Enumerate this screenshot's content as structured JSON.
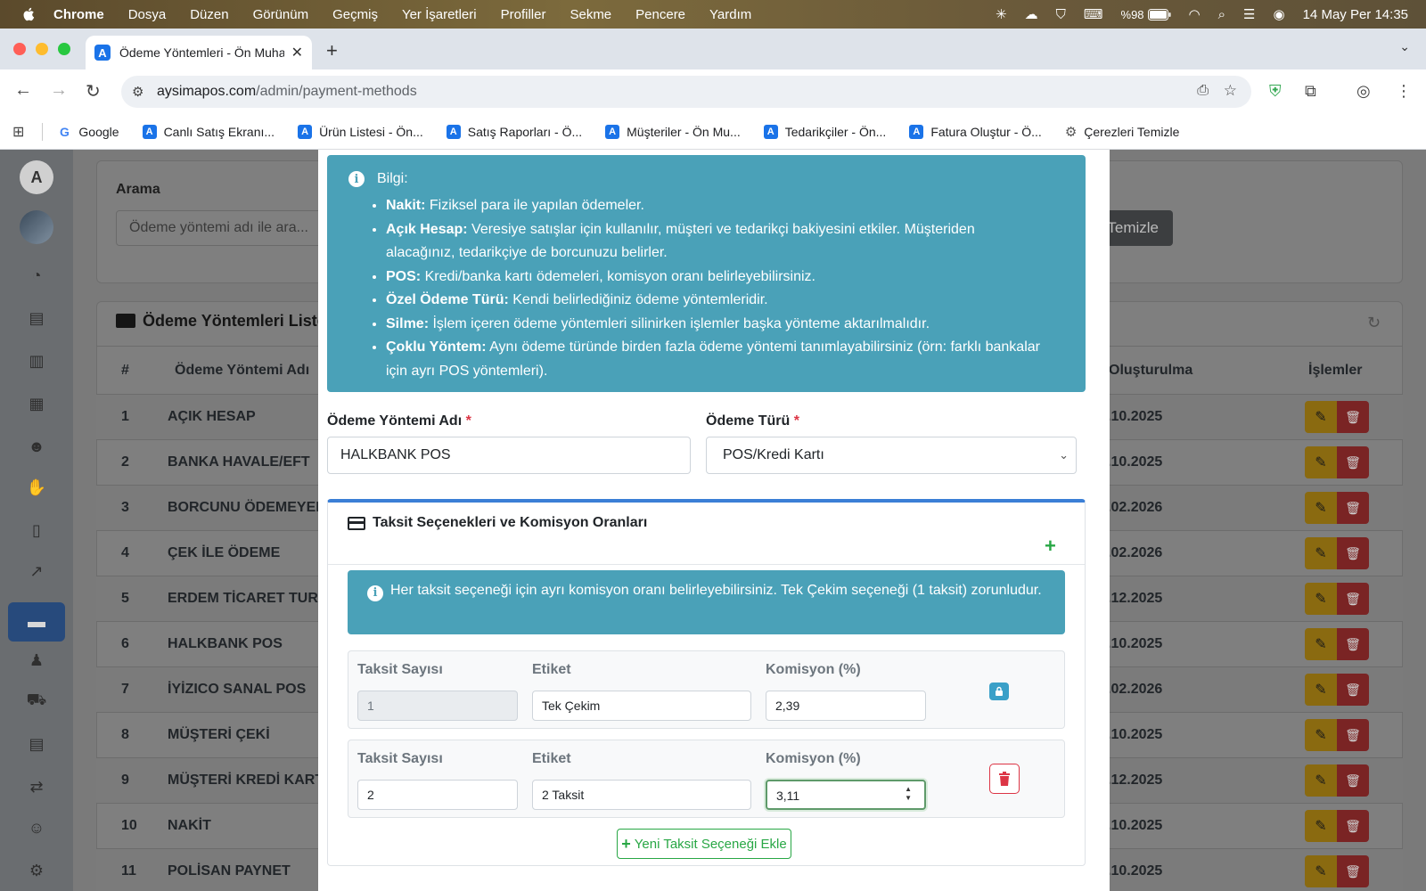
{
  "menubar": {
    "app": "Chrome",
    "items": [
      "Dosya",
      "Düzen",
      "Görünüm",
      "Geçmiş",
      "Yer İşaretleri",
      "Profiller",
      "Sekme",
      "Pencere",
      "Yardım"
    ],
    "battery": "%98",
    "clock": "14 May Per  14:35"
  },
  "browser": {
    "tab_title": "Ödeme Yöntemleri - Ön Muha",
    "url_host": "aysimapos.com",
    "url_path": "/admin/payment-methods",
    "bookmarks": [
      "Google",
      "Canlı Satış Ekranı...",
      "Ürün Listesi - Ön...",
      "Satış Raporları - Ö...",
      "Müşteriler - Ön Mu...",
      "Tedarikçiler - Ön...",
      "Fatura Oluştur - Ö...",
      "Çerezleri Temizle"
    ]
  },
  "background": {
    "search_label": "Arama",
    "search_placeholder": "Ödeme yöntemi adı ile ara...",
    "clear_button": "Temizle",
    "list_title": "Ödeme Yöntemleri Listesi",
    "col_num": "#",
    "col_name": "Ödeme Yöntemi Adı",
    "col_created": "Oluşturulma",
    "col_actions": "İşlemler",
    "rows": [
      {
        "num": "1",
        "name": "AÇIK HESAP",
        "date": ".10.2025"
      },
      {
        "num": "2",
        "name": "BANKA HAVALE/EFT",
        "date": ".10.2025"
      },
      {
        "num": "3",
        "name": "BORCUNU ÖDEMEYEN",
        "date": ".02.2026"
      },
      {
        "num": "4",
        "name": "ÇEK İLE ÖDEME",
        "date": ".02.2026"
      },
      {
        "num": "5",
        "name": "ERDEM TİCARET TURK",
        "date": ".12.2025"
      },
      {
        "num": "6",
        "name": "HALKBANK POS",
        "date": ".10.2025"
      },
      {
        "num": "7",
        "name": "İYİZICO SANAL POS",
        "date": ".02.2026"
      },
      {
        "num": "8",
        "name": "MÜŞTERİ ÇEKİ",
        "date": ".10.2025"
      },
      {
        "num": "9",
        "name": "MÜŞTERİ KREDİ KART",
        "date": ".12.2025"
      },
      {
        "num": "10",
        "name": "NAKİT",
        "date": ".10.2025"
      },
      {
        "num": "11",
        "name": "POLİSAN PAYNET",
        "date": ".10.2025"
      }
    ]
  },
  "modal": {
    "info_title": "Bilgi:",
    "info_items": [
      {
        "term": "Nakit:",
        "text": " Fiziksel para ile yapılan ödemeler."
      },
      {
        "term": "Açık Hesap:",
        "text": " Veresiye satışlar için kullanılır, müşteri ve tedarikçi bakiyesini etkiler. Müşteriden alacağınız, tedarikçiye de borcunuzu belirler."
      },
      {
        "term": "POS:",
        "text": " Kredi/banka kartı ödemeleri, komisyon oranı belirleyebilirsiniz."
      },
      {
        "term": "Özel Ödeme Türü:",
        "text": " Kendi belirlediğiniz ödeme yöntemleridir."
      },
      {
        "term": "Silme:",
        "text": " İşlem içeren ödeme yöntemleri silinirken işlemler başka yönteme aktarılmalıdır."
      },
      {
        "term": "Çoklu Yöntem:",
        "text": " Aynı ödeme türünde birden fazla ödeme yöntemi tanımlayabilirsiniz (örn: farklı bankalar için ayrı POS yöntemleri)."
      }
    ],
    "name_label": "Ödeme Yöntemi Adı",
    "name_value": "HALKBANK POS",
    "type_label": "Ödeme Türü",
    "type_value": "POS/Kredi Kartı",
    "required_mark": "*",
    "installment_title": "Taksit Seçenekleri ve Komisyon Oranları",
    "installment_info": "Her taksit seçeneği için ayrı komisyon oranı belirleyebilirsiniz. Tek Çekim seçeneği (1 taksit) zorunludur.",
    "col_count": "Taksit Sayısı",
    "col_label": "Etiket",
    "col_commission": "Komisyon (%)",
    "installments": [
      {
        "count": "1",
        "label": "Tek Çekim",
        "commission": "2,39"
      },
      {
        "count": "2",
        "label": "2 Taksit",
        "commission": "3,11"
      }
    ],
    "add_button": "Yeni Taksit Seçeneği Ekle"
  },
  "colors": {
    "info": "#4aa1b8",
    "success": "#28a745",
    "danger": "#dc3545",
    "primary_border": "#3b7fd6"
  }
}
